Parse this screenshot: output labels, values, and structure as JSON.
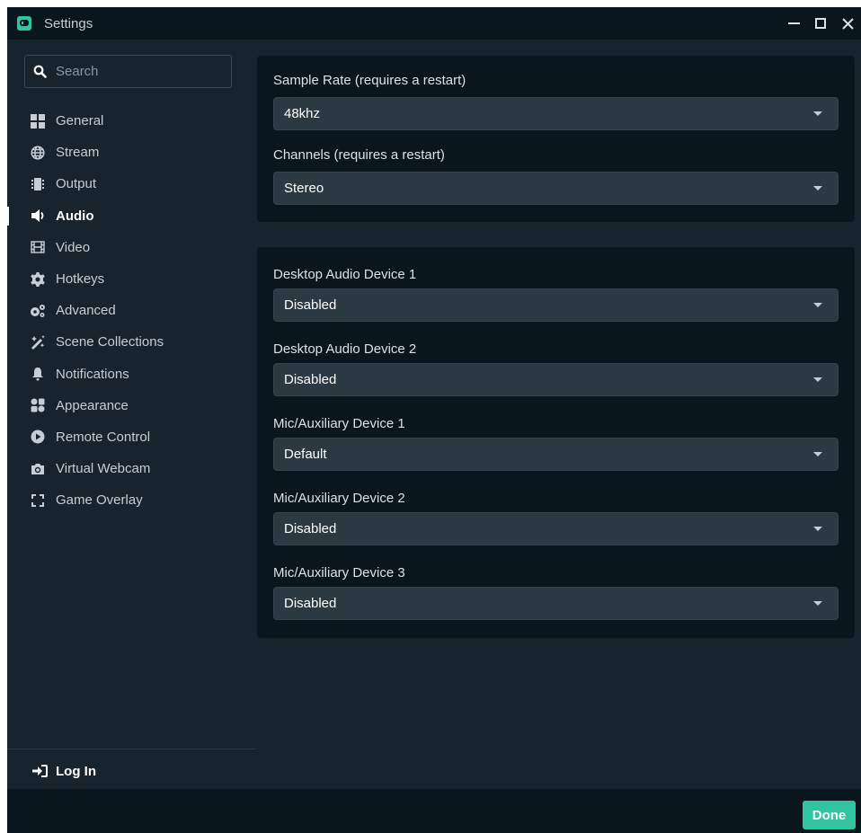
{
  "window": {
    "title": "Settings",
    "logo_icon": "streamlabs-logo-icon"
  },
  "colors": {
    "window_bg": "#17242d",
    "panel_bg": "#09161d",
    "select_bg": "#2b3942",
    "accent": "#31c3a2",
    "text": "#dbe1e5"
  },
  "search": {
    "placeholder": "Search",
    "value": ""
  },
  "sidebar": {
    "items": [
      {
        "label": "General",
        "icon": "grid-icon"
      },
      {
        "label": "Stream",
        "icon": "globe-icon"
      },
      {
        "label": "Output",
        "icon": "output-icon"
      },
      {
        "label": "Audio",
        "icon": "speaker-icon",
        "active": true
      },
      {
        "label": "Video",
        "icon": "film-icon"
      },
      {
        "label": "Hotkeys",
        "icon": "gear-icon"
      },
      {
        "label": "Advanced",
        "icon": "gears-icon"
      },
      {
        "label": "Scene Collections",
        "icon": "magic-icon"
      },
      {
        "label": "Notifications",
        "icon": "bell-icon"
      },
      {
        "label": "Appearance",
        "icon": "appearance-icon"
      },
      {
        "label": "Remote Control",
        "icon": "play-circle-icon"
      },
      {
        "label": "Virtual Webcam",
        "icon": "camera-icon"
      },
      {
        "label": "Game Overlay",
        "icon": "overlay-icon"
      }
    ],
    "login_label": "Log In"
  },
  "audio": {
    "general": [
      {
        "label": "Sample Rate (requires a restart)",
        "value": "48khz"
      },
      {
        "label": "Channels (requires a restart)",
        "value": "Stereo"
      }
    ],
    "devices": [
      {
        "label": "Desktop Audio Device 1",
        "value": "Disabled"
      },
      {
        "label": "Desktop Audio Device 2",
        "value": "Disabled"
      },
      {
        "label": "Mic/Auxiliary Device 1",
        "value": "Default"
      },
      {
        "label": "Mic/Auxiliary Device 2",
        "value": "Disabled"
      },
      {
        "label": "Mic/Auxiliary Device 3",
        "value": "Disabled"
      }
    ]
  },
  "footer": {
    "done_label": "Done"
  }
}
